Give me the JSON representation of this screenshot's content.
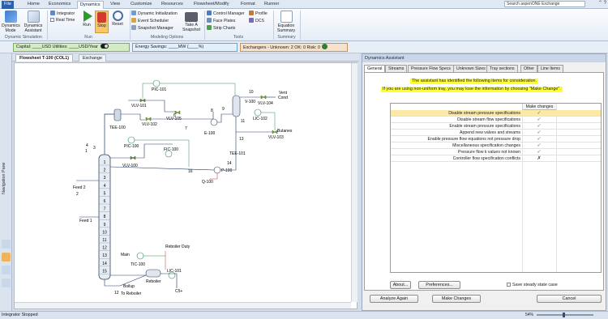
{
  "ribbon_tabs": [
    "File",
    "Home",
    "Economics",
    "Dynamics",
    "View",
    "Customize",
    "Resources",
    "Flowsheet/Modify",
    "Format",
    "Runner"
  ],
  "active_tab": "Dynamics",
  "search": {
    "placeholder": "Search aspenONE Exchange"
  },
  "window_controls": "⌃ ?",
  "ribbon": {
    "dyn_sim": {
      "mode": "Dynamics Mode",
      "assistant": "Dynamics Assistant",
      "label": "Dynamic Simulation"
    },
    "run": {
      "integrator": "Integrator",
      "real_time": "Real Time",
      "run": "Run",
      "stop": "Stop",
      "reset": "Reset",
      "label": "Run"
    },
    "modeling": {
      "dyn_init": "Dynamic Initialization",
      "event_sched": "Event Scheduler",
      "snapshot_mgr": "Snapshot Manager",
      "take_snapshot": "Take A Snapshot",
      "label": "Modeling Options"
    },
    "tools": {
      "control_mgr": "Control Manager",
      "face_plates": "Face Plates",
      "strip_charts": "Strip Charts",
      "profile": "Profile",
      "dcs": "DCS",
      "label": "Tools"
    },
    "summary": {
      "equation": "Equation Summary",
      "label": "Summary"
    }
  },
  "energy_bar": {
    "cost": "Capital: ____USD  Utilities: ____USD/Year",
    "energy": "Energy Savings: ____MW  (____%)",
    "exchangers": "Exchangers - Unknown: 2   OK: 0   Risk: 0"
  },
  "nav_label": "Navigation Pane",
  "flowsheet_tabs": [
    "Flowsheet T-100 (COL1)",
    "Exchange"
  ],
  "flowsheet": {
    "labels": {
      "pic101": "PIC-101",
      "vlv101": "VLV-101",
      "vlv102": "VLV-102",
      "vlv105": "VLV-105",
      "vlv104": "VLV-104",
      "vlv103": "VLV-103",
      "vlv100": "VLV-100",
      "tee100": "TEE-100",
      "pic100": "PIC-100",
      "fic100": "FIC-100",
      "v100": "V-100",
      "lic102": "LIC-102",
      "tee101": "TEE-101",
      "e100": "E-100",
      "p100": "P-100",
      "q100": "Q-100",
      "tic100": "TIC-100",
      "lic101": "LIC-101",
      "reboiler": "Reboiler",
      "reboiler_duty": "Reboiler Duty",
      "vent": "Vent",
      "cond": "Cond",
      "butanes": "Butanes",
      "feed2": "Feed 2",
      "feed1": "Feed 1",
      "main": "Main",
      "boilup": "Boilup",
      "to_reb": "To Reboiler",
      "c5": "C5+",
      "s10": "10",
      "s11": "11",
      "s12": "12",
      "s13": "13",
      "s9": "9",
      "s7": "7",
      "s6": "6",
      "s8": "8",
      "s16": "16",
      "s14": "14",
      "s4": "4",
      "s3": "3",
      "s1": "1",
      "s2": "2"
    },
    "trays": [
      "1",
      "2",
      "3",
      "4",
      "5",
      "6",
      "7",
      "8",
      "9",
      "10",
      "11",
      "12",
      "13",
      "14",
      "15"
    ]
  },
  "assistant": {
    "title": "Dynamics Assistant",
    "tabs": [
      "General",
      "Streams",
      "Pressure Flow Specs",
      "Unknown Sizes",
      "Tray sections",
      "Other",
      "Line Items"
    ],
    "notice1": "The assistant has identified the following items for consideration.",
    "notice2": "If you are using non-uniform tray, you may lose the information by choosing \"Make Change\".",
    "col_header": "Make changes",
    "items": [
      {
        "label": "Disable stream pressure specifications",
        "mark": "✓"
      },
      {
        "label": "Disable stream flow specifications",
        "mark": "✓"
      },
      {
        "label": "Enable stream pressure specifications",
        "mark": "✓"
      },
      {
        "label": "Append new valves and streams",
        "mark": "✓"
      },
      {
        "label": "Enable pressure flow equations not pressure drop",
        "mark": "✓"
      },
      {
        "label": "Miscellaneous specification changes",
        "mark": "✓"
      },
      {
        "label": "Pressure flow k values not known",
        "mark": "✓"
      },
      {
        "label": "Controller flow specification conflicts",
        "mark": "✗"
      }
    ],
    "about": "About...",
    "preferences": "Preferences...",
    "save_steady": "Save steady state case",
    "analyze": "Analyze Again",
    "make_changes": "Make Changes",
    "cancel": "Cancel"
  },
  "status": "Integrator Stopped",
  "zoom": "54%"
}
